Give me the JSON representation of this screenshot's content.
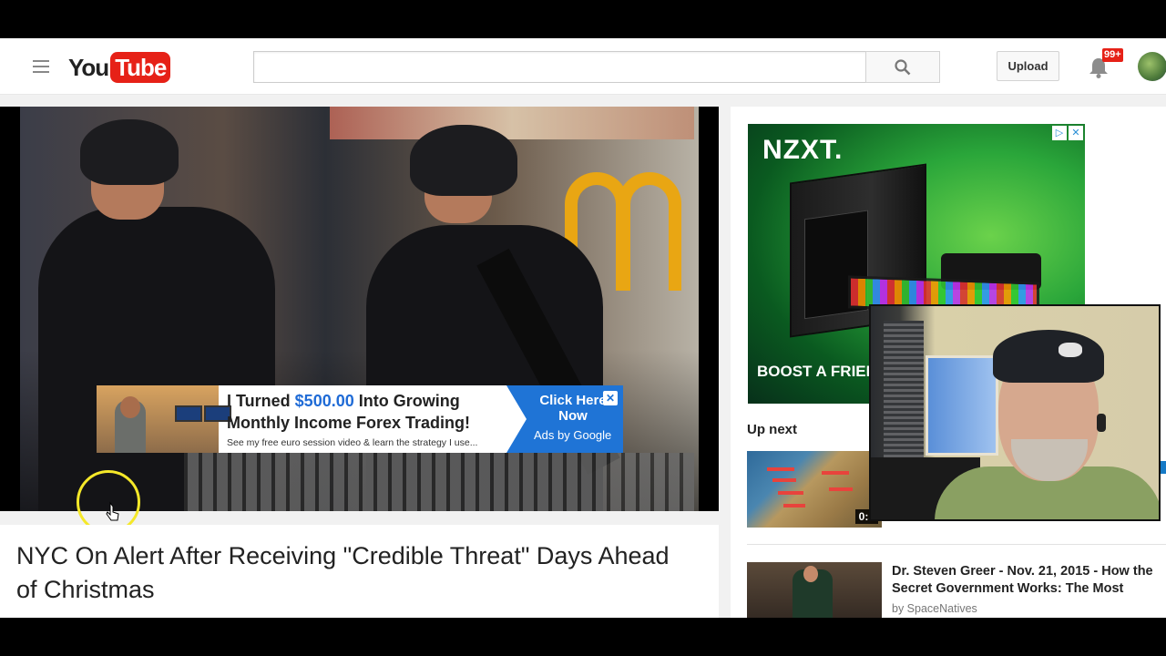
{
  "header": {
    "logo_you": "You",
    "logo_tube": "Tube",
    "search_placeholder": "",
    "upload_label": "Upload",
    "notification_count": "99+",
    "brand_red": "#e62117"
  },
  "player": {
    "overlay_ad": {
      "line1_prefix": "I Turned ",
      "line1_amount": "$500.00",
      "line1_suffix": " Into Growing",
      "line2": "Monthly Income Forex Trading!",
      "subtext": "See my free euro session video & learn the strategy I use...",
      "cta": "Click Here Now",
      "ads_by": "Ads by Google",
      "close_symbol": "✕",
      "accent_color": "#1f74d6"
    }
  },
  "video": {
    "title": "NYC On Alert After Receiving \"Credible Threat\" Days Ahead of Christmas"
  },
  "sidebar": {
    "ad": {
      "brand": "NZXT.",
      "cta": "BOOST A FRIEND",
      "choices_icon": "▷",
      "close_icon": "✕",
      "accent_color": "#2aa63a"
    },
    "up_next_label": "Up next",
    "up_next": {
      "duration": "0:5"
    },
    "recommendations": [
      {
        "title_line1": "Dr. Steven Greer - Nov. 21, 2015 - How the",
        "title_line2": "Secret Government Works: The Most",
        "channel": "by SpaceNatives"
      }
    ]
  }
}
